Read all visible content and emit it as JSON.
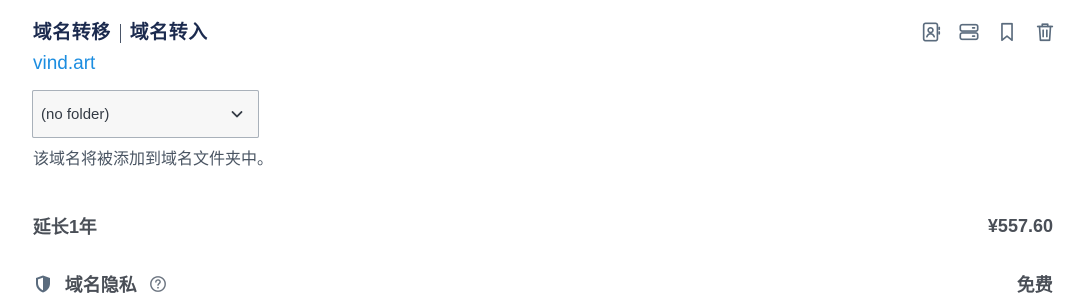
{
  "header": {
    "title_left": "域名转移",
    "title_right": "域名转入",
    "domain": "vind.art"
  },
  "toolbar": {
    "icons": [
      "contact-card-icon",
      "server-icon",
      "bookmark-icon",
      "trash-icon"
    ]
  },
  "folder": {
    "selected": "(no folder)",
    "helper_text": "该域名将被添加到域名文件夹中。"
  },
  "extend": {
    "label": "延长1年",
    "price": "¥557.60"
  },
  "privacy": {
    "label": "域名隐私",
    "price": "免费"
  },
  "colors": {
    "link": "#1c8de0",
    "title": "#1b2a4e",
    "icon": "#5a6b7d"
  }
}
